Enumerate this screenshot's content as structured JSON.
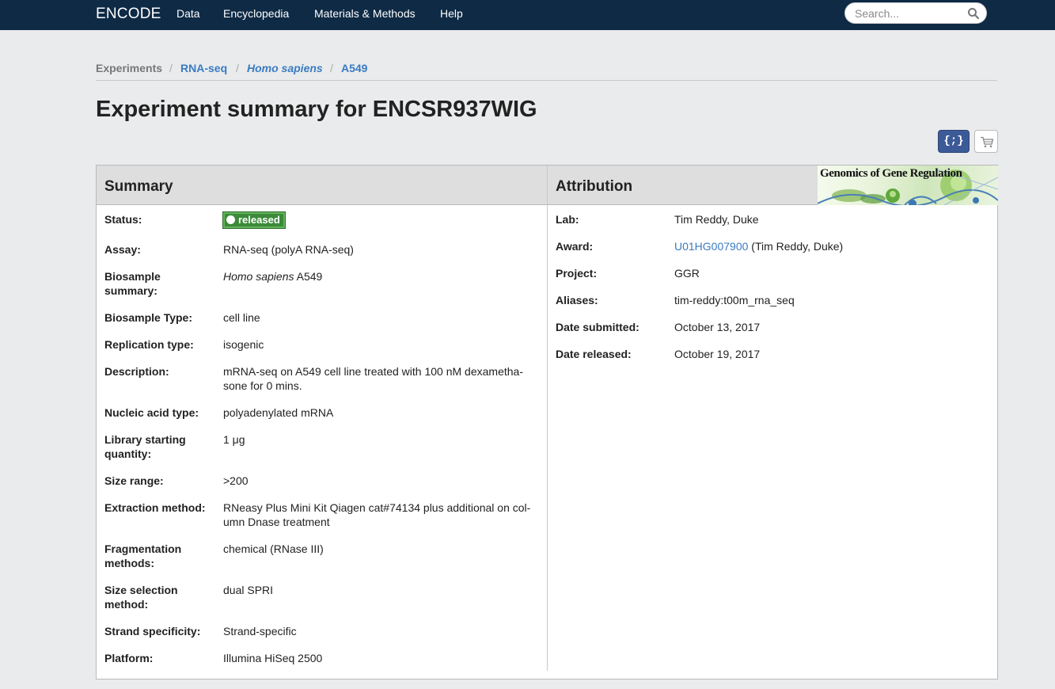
{
  "nav": {
    "brand": "ENCODE",
    "items": [
      "Data",
      "Encyclopedia",
      "Materials & Methods",
      "Help"
    ],
    "search_placeholder": "Search..."
  },
  "breadcrumb": {
    "items": [
      "Experiments",
      "RNA-seq",
      "Homo sapiens",
      "A549"
    ],
    "separator": "/"
  },
  "page_title": "Experiment summary for ENCSR937WIG",
  "toolbar": {
    "json_label": "{;}"
  },
  "summary": {
    "heading": "Summary",
    "status_label": "Status:",
    "status_value": "released",
    "assay_label": "Assay:",
    "assay_value": "RNA-seq (polyA RNA-seq)",
    "biosample_summary_label": "Biosample summary:",
    "biosample_summary_organism": "Homo sapiens",
    "biosample_summary_rest": " A549",
    "biosample_type_label": "Biosample Type:",
    "biosample_type_value": "cell line",
    "replication_type_label": "Replication type:",
    "replication_type_value": "isogenic",
    "description_label": "Description:",
    "description_value": "mRNA-seq on A549 cell line treated with 100 nM dexametha-sone for 0 mins.",
    "nucleic_acid_label": "Nucleic acid type:",
    "nucleic_acid_value": "polyadenylated mRNA",
    "library_qty_label": "Library starting quantity:",
    "library_qty_value": "1 μg",
    "size_range_label": "Size range:",
    "size_range_value": ">200",
    "extraction_label": "Extraction method:",
    "extraction_value": "RNeasy Plus Mini Kit Qiagen cat#74134 plus additional on col-umn Dnase treatment",
    "fragmentation_label": "Fragmentation methods:",
    "fragmentation_value": "chemical (RNase III)",
    "size_selection_label": "Size selection method:",
    "size_selection_value": "dual SPRI",
    "strand_label": "Strand specificity:",
    "strand_value": "Strand-specific",
    "platform_label": "Platform:",
    "platform_value": "Illumina HiSeq 2500"
  },
  "attribution": {
    "heading": "Attribution",
    "logo_text": "Genomics of Gene Regulation",
    "lab_label": "Lab:",
    "lab_value": "Tim Reddy, Duke",
    "award_label": "Award:",
    "award_link": "U01HG007900",
    "award_rest": " (Tim Reddy, Duke)",
    "project_label": "Project:",
    "project_value": "GGR",
    "aliases_label": "Aliases:",
    "aliases_value": "tim-reddy:t00m_rna_seq",
    "date_submitted_label": "Date submitted:",
    "date_submitted_value": "October 13, 2017",
    "date_released_label": "Date released:",
    "date_released_value": "October 19, 2017"
  },
  "colors": {
    "navbar": "#0e2a45",
    "link": "#3a7bc2",
    "status_released": "#3a8a3a",
    "json_button": "#3d5a98"
  }
}
